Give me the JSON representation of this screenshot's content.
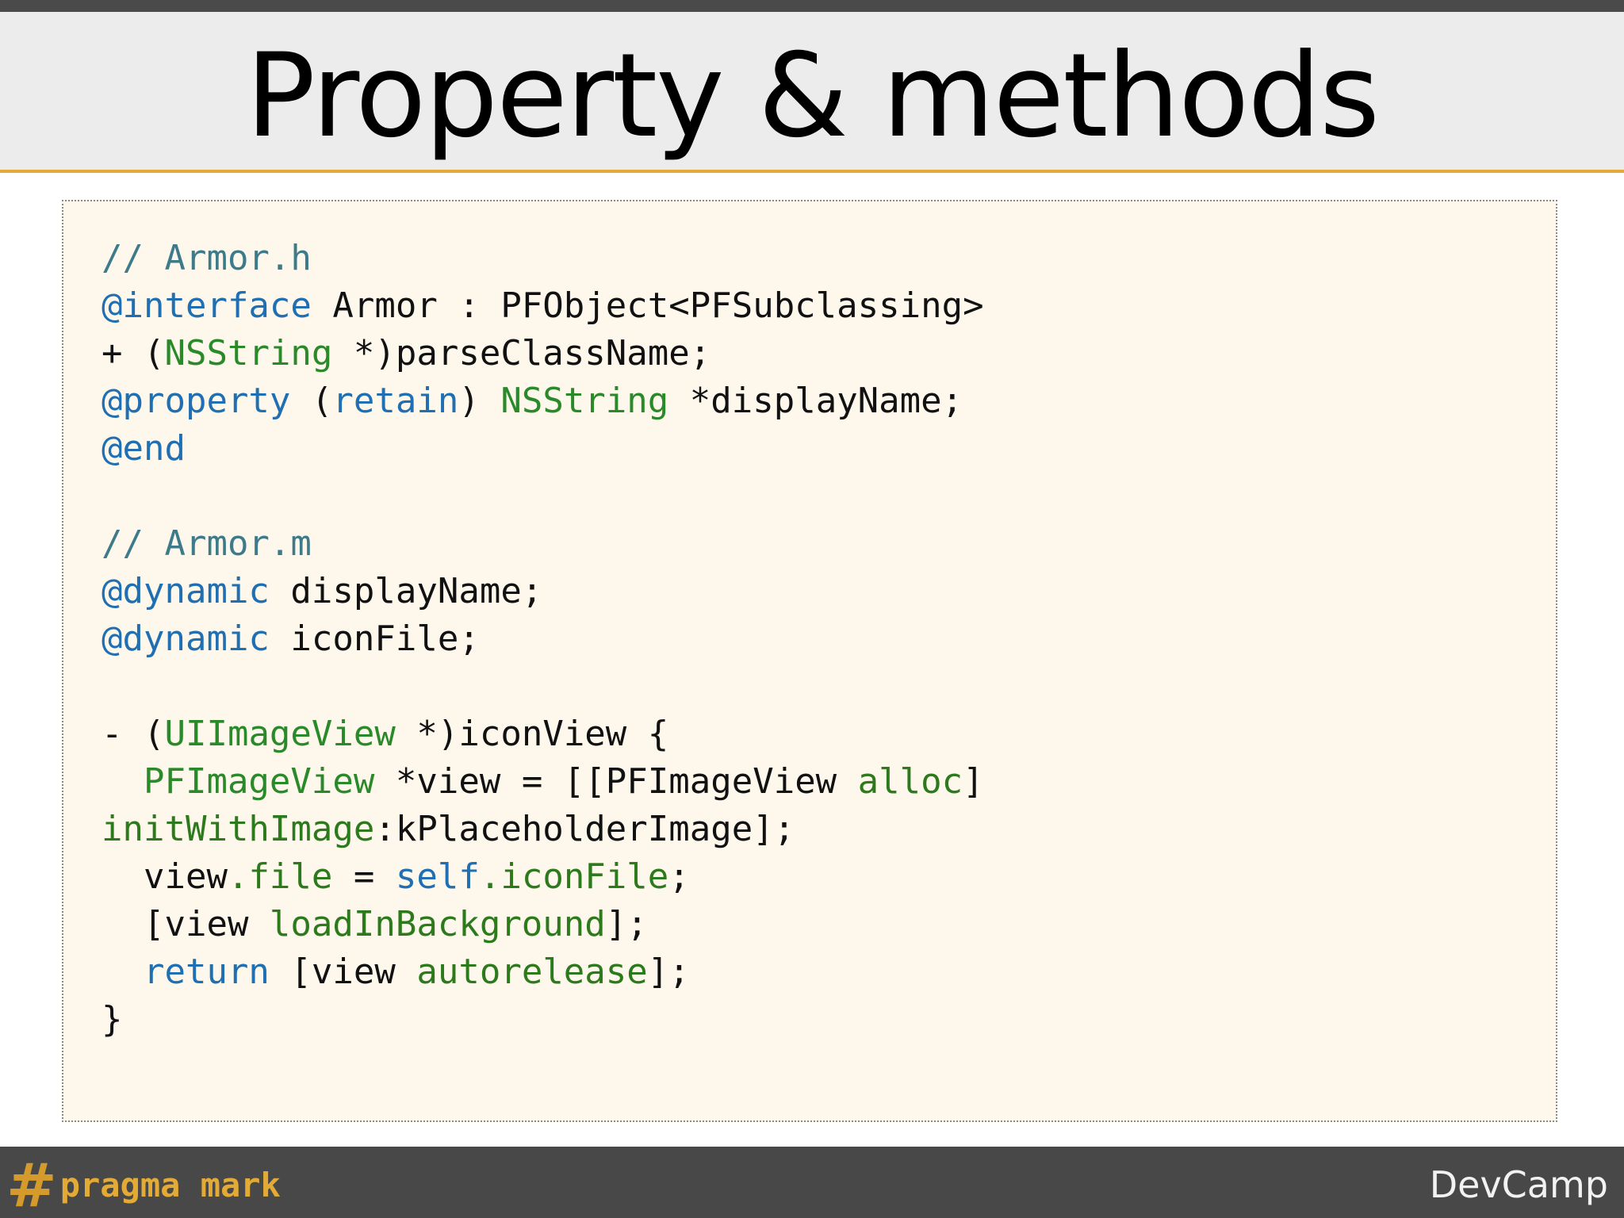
{
  "slide": {
    "title": "Property & methods"
  },
  "code": {
    "lines": [
      [
        {
          "t": "// Armor.h",
          "c": "comment"
        }
      ],
      [
        {
          "t": "@interface",
          "c": "keyword"
        },
        {
          "t": " Armor : PFObject<PFSubclassing>",
          "c": "plain"
        }
      ],
      [
        {
          "t": "+ (",
          "c": "plain"
        },
        {
          "t": "NSString",
          "c": "type"
        },
        {
          "t": " *)parseClassName;",
          "c": "plain"
        }
      ],
      [
        {
          "t": "@property",
          "c": "keyword"
        },
        {
          "t": " (",
          "c": "plain"
        },
        {
          "t": "retain",
          "c": "keyword"
        },
        {
          "t": ") ",
          "c": "plain"
        },
        {
          "t": "NSString",
          "c": "type"
        },
        {
          "t": " *displayName;",
          "c": "plain"
        }
      ],
      [
        {
          "t": "@end",
          "c": "keyword"
        }
      ],
      [],
      [
        {
          "t": "// Armor.m",
          "c": "comment"
        }
      ],
      [
        {
          "t": "@dynamic",
          "c": "keyword"
        },
        {
          "t": " displayName;",
          "c": "plain"
        }
      ],
      [
        {
          "t": "@dynamic",
          "c": "keyword"
        },
        {
          "t": " iconFile;",
          "c": "plain"
        }
      ],
      [],
      [
        {
          "t": "- (",
          "c": "plain"
        },
        {
          "t": "UIImageView",
          "c": "type"
        },
        {
          "t": " *)iconView {",
          "c": "plain"
        }
      ],
      [
        {
          "t": "  ",
          "c": "plain"
        },
        {
          "t": "PFImageView",
          "c": "type"
        },
        {
          "t": " *view = [[PFImageView ",
          "c": "plain"
        },
        {
          "t": "alloc",
          "c": "method"
        },
        {
          "t": "]",
          "c": "plain"
        }
      ],
      [
        {
          "t": "initWithImage",
          "c": "method"
        },
        {
          "t": ":kPlaceholderImage];",
          "c": "plain"
        }
      ],
      [
        {
          "t": "  view",
          "c": "plain"
        },
        {
          "t": ".file",
          "c": "method"
        },
        {
          "t": " = ",
          "c": "plain"
        },
        {
          "t": "self",
          "c": "keyword"
        },
        {
          "t": ".iconFile",
          "c": "method"
        },
        {
          "t": ";",
          "c": "plain"
        }
      ],
      [
        {
          "t": "  [view ",
          "c": "plain"
        },
        {
          "t": "loadInBackground",
          "c": "method"
        },
        {
          "t": "];",
          "c": "plain"
        }
      ],
      [
        {
          "t": "  ",
          "c": "plain"
        },
        {
          "t": "return",
          "c": "keyword"
        },
        {
          "t": " [view ",
          "c": "plain"
        },
        {
          "t": "autorelease",
          "c": "method"
        },
        {
          "t": "];",
          "c": "plain"
        }
      ],
      [
        {
          "t": "}",
          "c": "plain"
        }
      ]
    ]
  },
  "footer": {
    "logo_symbol": "#",
    "logo_text": "pragma mark",
    "brand": "DevCamp"
  },
  "colors": {
    "accent_rule": "#e0a93a",
    "code_background": "#fdf7ec",
    "comment": "#3e7b8a",
    "keyword": "#1f6fb2",
    "type": "#2a8a2a",
    "method": "#2d7a1c",
    "footer_background": "#484848",
    "logo": "#e3aa36"
  }
}
